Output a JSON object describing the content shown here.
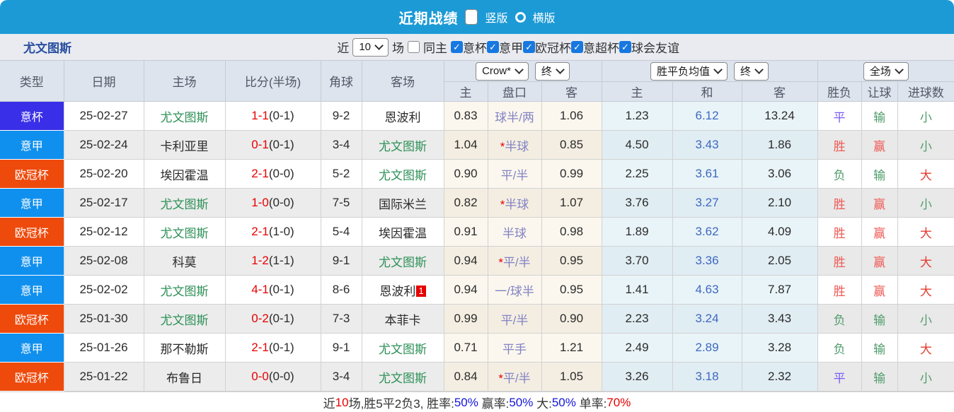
{
  "title_bar": {
    "title": "近期战绩",
    "options": [
      {
        "label": "竖版",
        "selected": true
      },
      {
        "label": "横版",
        "selected": false
      }
    ]
  },
  "filter_bar": {
    "team": "尤文图斯",
    "recent_label": "近",
    "recent_value": "10",
    "games_label": "场",
    "same_home": {
      "label": "同主",
      "checked": false
    },
    "leagues": [
      {
        "label": "意杯",
        "checked": true
      },
      {
        "label": "意甲",
        "checked": true
      },
      {
        "label": "欧冠杯",
        "checked": true
      },
      {
        "label": "意超杯",
        "checked": true
      },
      {
        "label": "球会友谊",
        "checked": true
      }
    ]
  },
  "table": {
    "main_headers": [
      "类型",
      "日期",
      "主场",
      "比分(半场)",
      "角球",
      "客场"
    ],
    "groups": [
      {
        "selects": [
          "Crow*",
          "终"
        ],
        "sub": [
          "主",
          "盘口",
          "客"
        ]
      },
      {
        "selects": [
          "胜平负均值",
          "终"
        ],
        "sub": [
          "主",
          "和",
          "客"
        ]
      },
      {
        "selects": [
          "全场"
        ],
        "sub": [
          "胜负",
          "让球",
          "进球数"
        ]
      }
    ],
    "rows": [
      {
        "type": "意杯",
        "date": "25-02-27",
        "home": "尤文图斯",
        "score": "1-1",
        "half": "(0-1)",
        "corner": "9-2",
        "away": "恩波利",
        "o1": "0.83",
        "hcp": "球半/两",
        "o2": "1.06",
        "a1": "1.23",
        "a2": "6.12",
        "a3": "13.24",
        "r1": "平",
        "r2": "输",
        "r3": "小"
      },
      {
        "type": "意甲",
        "date": "25-02-24",
        "home": "卡利亚里",
        "score": "0-1",
        "half": "(0-1)",
        "corner": "3-4",
        "away": "尤文图斯",
        "o1": "1.04",
        "hcp": "*半球",
        "o2": "0.85",
        "a1": "4.50",
        "a2": "3.43",
        "a3": "1.86",
        "r1": "胜",
        "r2": "赢",
        "r3": "小"
      },
      {
        "type": "欧冠杯",
        "date": "25-02-20",
        "home": "埃因霍温",
        "score": "2-1",
        "half": "(0-0)",
        "corner": "5-2",
        "away": "尤文图斯",
        "o1": "0.90",
        "hcp": "平/半",
        "o2": "0.99",
        "a1": "2.25",
        "a2": "3.61",
        "a3": "3.06",
        "r1": "负",
        "r2": "输",
        "r3": "大"
      },
      {
        "type": "意甲",
        "date": "25-02-17",
        "home": "尤文图斯",
        "score": "1-0",
        "half": "(0-0)",
        "corner": "7-5",
        "away": "国际米兰",
        "o1": "0.82",
        "hcp": "*半球",
        "o2": "1.07",
        "a1": "3.76",
        "a2": "3.27",
        "a3": "2.10",
        "r1": "胜",
        "r2": "赢",
        "r3": "小"
      },
      {
        "type": "欧冠杯",
        "date": "25-02-12",
        "home": "尤文图斯",
        "score": "2-1",
        "half": "(1-0)",
        "corner": "5-4",
        "away": "埃因霍温",
        "o1": "0.91",
        "hcp": "半球",
        "o2": "0.98",
        "a1": "1.89",
        "a2": "3.62",
        "a3": "4.09",
        "r1": "胜",
        "r2": "赢",
        "r3": "大"
      },
      {
        "type": "意甲",
        "date": "25-02-08",
        "home": "科莫",
        "score": "1-2",
        "half": "(1-1)",
        "corner": "9-1",
        "away": "尤文图斯",
        "o1": "0.94",
        "hcp": "*平/半",
        "o2": "0.95",
        "a1": "3.70",
        "a2": "3.36",
        "a3": "2.05",
        "r1": "胜",
        "r2": "赢",
        "r3": "大"
      },
      {
        "type": "意甲",
        "date": "25-02-02",
        "home": "尤文图斯",
        "score": "4-1",
        "half": "(0-1)",
        "corner": "8-6",
        "away": "恩波利",
        "away_badge": "1",
        "o1": "0.94",
        "hcp": "一/球半",
        "o2": "0.95",
        "a1": "1.41",
        "a2": "4.63",
        "a3": "7.87",
        "r1": "胜",
        "r2": "赢",
        "r3": "大"
      },
      {
        "type": "欧冠杯",
        "date": "25-01-30",
        "home": "尤文图斯",
        "score": "0-2",
        "half": "(0-1)",
        "corner": "7-3",
        "away": "本菲卡",
        "o1": "0.99",
        "hcp": "平/半",
        "o2": "0.90",
        "a1": "2.23",
        "a2": "3.24",
        "a3": "3.43",
        "r1": "负",
        "r2": "输",
        "r3": "小"
      },
      {
        "type": "意甲",
        "date": "25-01-26",
        "home": "那不勒斯",
        "score": "2-1",
        "half": "(0-1)",
        "corner": "9-1",
        "away": "尤文图斯",
        "o1": "0.71",
        "hcp": "平手",
        "o2": "1.21",
        "a1": "2.49",
        "a2": "2.89",
        "a3": "3.28",
        "r1": "负",
        "r2": "输",
        "r3": "大"
      },
      {
        "type": "欧冠杯",
        "date": "25-01-22",
        "home": "布鲁日",
        "score": "0-0",
        "half": "(0-0)",
        "corner": "3-4",
        "away": "尤文图斯",
        "o1": "0.84",
        "hcp": "*平/半",
        "o2": "1.05",
        "a1": "3.26",
        "a2": "3.18",
        "a3": "2.32",
        "r1": "平",
        "r2": "输",
        "r3": "小"
      }
    ]
  },
  "summary": {
    "segments": [
      {
        "text": "近",
        "color": "#333333"
      },
      {
        "text": "10",
        "color": "#e60000"
      },
      {
        "text": "场,胜5平2负3, 胜率:",
        "color": "#333333"
      },
      {
        "text": "50%",
        "color": "#1414dd"
      },
      {
        "text": " 赢率:",
        "color": "#333333"
      },
      {
        "text": "50%",
        "color": "#1414dd"
      },
      {
        "text": " 大:",
        "color": "#333333"
      },
      {
        "text": "50%",
        "color": "#1414dd"
      },
      {
        "text": " 单率:",
        "color": "#333333"
      },
      {
        "text": "70%",
        "color": "#e60000"
      }
    ]
  },
  "colors": {
    "accent_blue": "#1c9ad6",
    "team_green": "#2e9058",
    "type_colors": {
      "意杯": "#3a2fe8",
      "意甲": "#1090ee",
      "欧冠杯": "#ee4a0c"
    },
    "result_colors": {
      "胜": "#ef5a55",
      "赢": "#ef5a55",
      "大": "#e63c30",
      "平": "#7a5cf5",
      "负": "#4f9c6b",
      "输": "#4f9c6b",
      "小": "#4f9c6b"
    }
  }
}
